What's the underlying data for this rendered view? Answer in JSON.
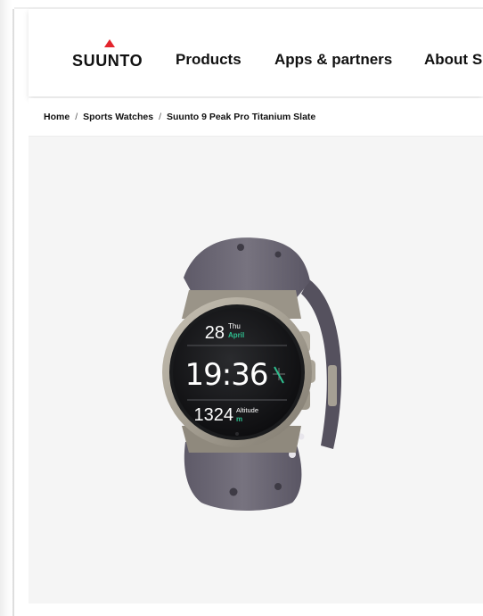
{
  "header": {
    "logo_text": "SUUNTO",
    "nav": [
      {
        "label": "Products"
      },
      {
        "label": "Apps & partners"
      },
      {
        "label": "About S"
      }
    ]
  },
  "breadcrumb": {
    "items": [
      "Home",
      "Sports Watches",
      "Suunto 9 Peak Pro Titanium Slate"
    ],
    "separator": "/"
  },
  "product": {
    "watch_face": {
      "date_day": "28",
      "date_weekday": "Thu",
      "date_month": "April",
      "time": "19:36",
      "altitude_value": "1324",
      "altitude_label": "Altitude",
      "altitude_unit": "m"
    }
  },
  "colors": {
    "brand_red": "#e3252d",
    "accent_green": "#2fbf8f",
    "strap_slate": "#6e6a78"
  }
}
